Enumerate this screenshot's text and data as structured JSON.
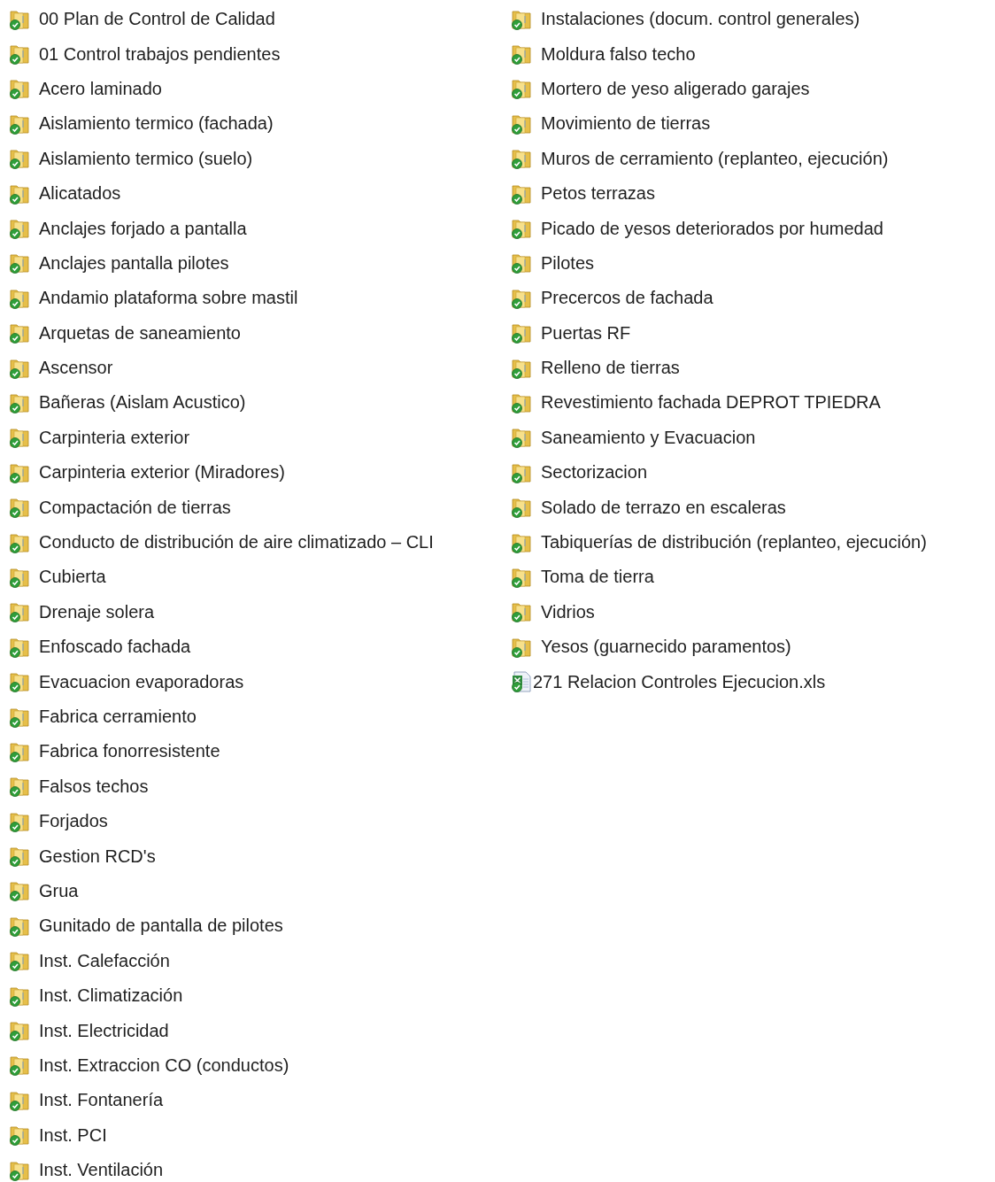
{
  "file_list": {
    "columns": [
      [
        {
          "kind": "folder",
          "name": "00 Plan de Control de Calidad"
        },
        {
          "kind": "folder",
          "name": "01 Control trabajos pendientes"
        },
        {
          "kind": "folder",
          "name": "Acero laminado"
        },
        {
          "kind": "folder",
          "name": "Aislamiento termico (fachada)"
        },
        {
          "kind": "folder",
          "name": "Aislamiento termico (suelo)"
        },
        {
          "kind": "folder",
          "name": "Alicatados"
        },
        {
          "kind": "folder",
          "name": "Anclajes forjado a pantalla"
        },
        {
          "kind": "folder",
          "name": "Anclajes pantalla pilotes"
        },
        {
          "kind": "folder",
          "name": "Andamio plataforma sobre mastil"
        },
        {
          "kind": "folder",
          "name": "Arquetas de saneamiento"
        },
        {
          "kind": "folder",
          "name": "Ascensor"
        },
        {
          "kind": "folder",
          "name": "Bañeras (Aislam Acustico)"
        },
        {
          "kind": "folder",
          "name": "Carpinteria exterior"
        },
        {
          "kind": "folder",
          "name": "Carpinteria exterior (Miradores)"
        },
        {
          "kind": "folder",
          "name": "Compactación de tierras"
        },
        {
          "kind": "folder",
          "name": "Conducto de distribución de aire climatizado – CLI"
        },
        {
          "kind": "folder",
          "name": "Cubierta"
        },
        {
          "kind": "folder",
          "name": "Drenaje solera"
        },
        {
          "kind": "folder",
          "name": "Enfoscado fachada"
        },
        {
          "kind": "folder",
          "name": "Evacuacion evaporadoras"
        },
        {
          "kind": "folder",
          "name": "Fabrica cerramiento"
        },
        {
          "kind": "folder",
          "name": "Fabrica fonorresistente"
        },
        {
          "kind": "folder",
          "name": "Falsos techos"
        },
        {
          "kind": "folder",
          "name": "Forjados"
        },
        {
          "kind": "folder",
          "name": "Gestion RCD's"
        },
        {
          "kind": "folder",
          "name": "Grua"
        },
        {
          "kind": "folder",
          "name": "Gunitado de pantalla de pilotes"
        },
        {
          "kind": "folder",
          "name": "Inst. Calefacción"
        },
        {
          "kind": "folder",
          "name": "Inst. Climatización"
        },
        {
          "kind": "folder",
          "name": "Inst. Electricidad"
        },
        {
          "kind": "folder",
          "name": "Inst. Extraccion CO (conductos)"
        },
        {
          "kind": "folder",
          "name": "Inst. Fontanería"
        },
        {
          "kind": "folder",
          "name": "Inst. PCI"
        },
        {
          "kind": "folder",
          "name": "Inst. Ventilación"
        }
      ],
      [
        {
          "kind": "folder",
          "name": "Instalaciones (docum. control generales)"
        },
        {
          "kind": "folder",
          "name": "Moldura falso techo"
        },
        {
          "kind": "folder",
          "name": "Mortero de yeso aligerado garajes"
        },
        {
          "kind": "folder",
          "name": "Movimiento de tierras"
        },
        {
          "kind": "folder",
          "name": "Muros de cerramiento (replanteo, ejecución)"
        },
        {
          "kind": "folder",
          "name": "Petos terrazas"
        },
        {
          "kind": "folder",
          "name": "Picado de yesos deteriorados por humedad"
        },
        {
          "kind": "folder",
          "name": "Pilotes"
        },
        {
          "kind": "folder",
          "name": "Precercos de fachada"
        },
        {
          "kind": "folder",
          "name": "Puertas RF"
        },
        {
          "kind": "folder",
          "name": "Relleno de tierras"
        },
        {
          "kind": "folder",
          "name": "Revestimiento fachada DEPROT TPIEDRA"
        },
        {
          "kind": "folder",
          "name": "Saneamiento y Evacuacion"
        },
        {
          "kind": "folder",
          "name": "Sectorizacion"
        },
        {
          "kind": "folder",
          "name": "Solado de terrazo en escaleras"
        },
        {
          "kind": "folder",
          "name": "Tabiquerías de distribución (replanteo, ejecución)"
        },
        {
          "kind": "folder",
          "name": "Toma de tierra"
        },
        {
          "kind": "folder",
          "name": "Vidrios"
        },
        {
          "kind": "folder",
          "name": "Yesos (guarnecido paramentos)"
        },
        {
          "kind": "spreadsheet",
          "name": "271 Relacion Controles Ejecucion.xls"
        }
      ]
    ]
  }
}
